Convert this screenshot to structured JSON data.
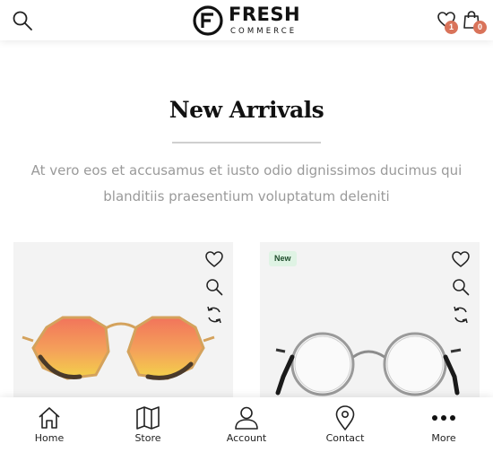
{
  "header": {
    "logo_title": "FRESH",
    "logo_subtitle": "COMMERCE",
    "wishlist_count": "1",
    "cart_count": "0",
    "icons": [
      "search-icon",
      "heart-icon",
      "shopping-bag-icon"
    ]
  },
  "section": {
    "title": "New Arrivals",
    "description": "At vero eos et accusamus et iusto odio dignissimos ducimus qui blanditiis praesentium voluptatum deleniti"
  },
  "products": [
    {
      "badge": "",
      "image": "orange-octagon-sunglasses",
      "actions": [
        "heart-icon",
        "zoom-icon",
        "compare-icon"
      ]
    },
    {
      "badge": "New",
      "image": "round-wire-eyeglasses",
      "actions": [
        "heart-icon",
        "zoom-icon",
        "compare-icon"
      ]
    }
  ],
  "bottom_nav": [
    {
      "label": "Home",
      "icon": "home-icon"
    },
    {
      "label": "Store",
      "icon": "map-icon"
    },
    {
      "label": "Account",
      "icon": "user-icon"
    },
    {
      "label": "Contact",
      "icon": "location-pin-icon"
    },
    {
      "label": "More",
      "icon": "more-dots-icon"
    }
  ]
}
